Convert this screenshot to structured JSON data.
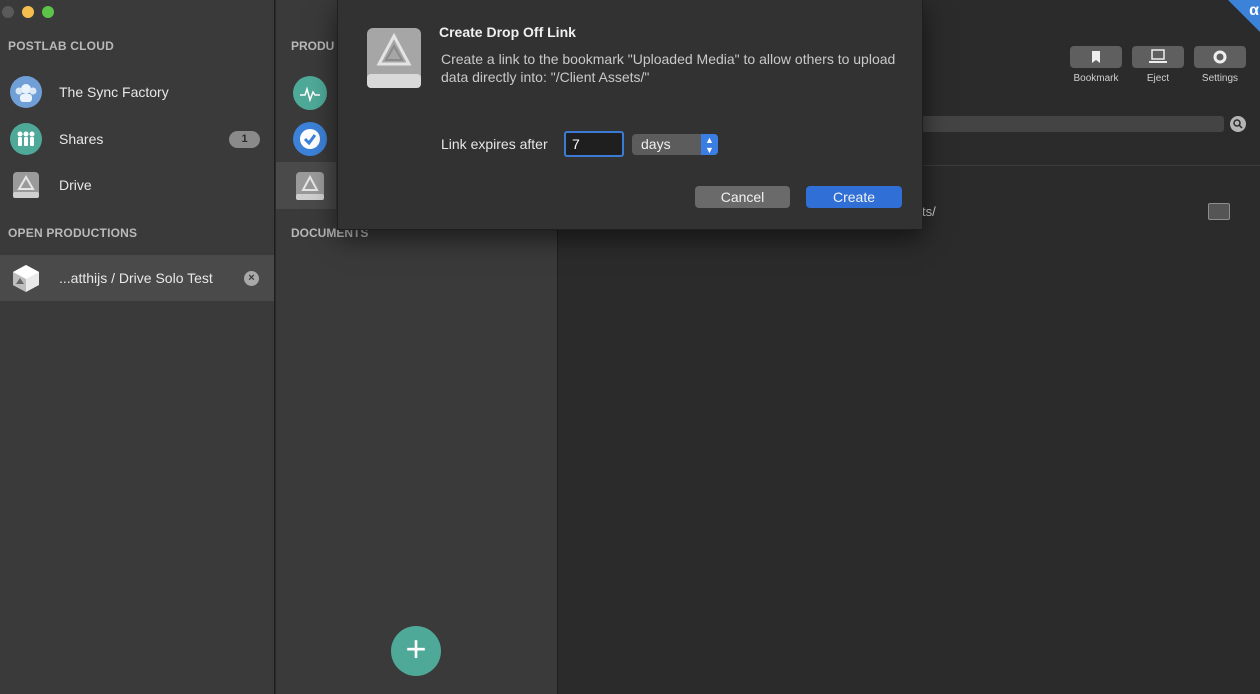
{
  "sidebar": {
    "section_cloud": "POSTLAB CLOUD",
    "items": [
      {
        "label": "The Sync Factory",
        "icon": "team-avatar-icon"
      },
      {
        "label": "Shares",
        "icon": "shares-icon",
        "badge": "1"
      },
      {
        "label": "Drive",
        "icon": "drive-icon"
      }
    ],
    "section_open": "OPEN PRODUCTIONS",
    "open_items": [
      {
        "label": "...atthijs / Drive Solo Test",
        "icon": "production-cube-icon",
        "close_label": "×"
      }
    ]
  },
  "middle": {
    "section_productions": "PRODU",
    "section_documents": "DOCUMENTS",
    "add_label": "+"
  },
  "toolbar": {
    "bookmark_label": "Bookmark",
    "eject_label": "Eject",
    "settings_label": "Settings"
  },
  "right": {
    "path_fragment": "ts/",
    "corner_text": "α"
  },
  "dialog": {
    "title": "Create Drop Off Link",
    "message": "Create a link to the bookmark \"Uploaded Media\" to allow others to upload data directly into: \"/Client Assets/\"",
    "expires_label": "Link expires after",
    "expires_value": "7",
    "unit_selected": "days",
    "cancel_label": "Cancel",
    "create_label": "Create"
  },
  "colors": {
    "accent": "#2f6fd6",
    "teal": "#4fa999",
    "sidebar_bg": "#3a3a3a",
    "pane_bg": "#2b2b2b"
  }
}
